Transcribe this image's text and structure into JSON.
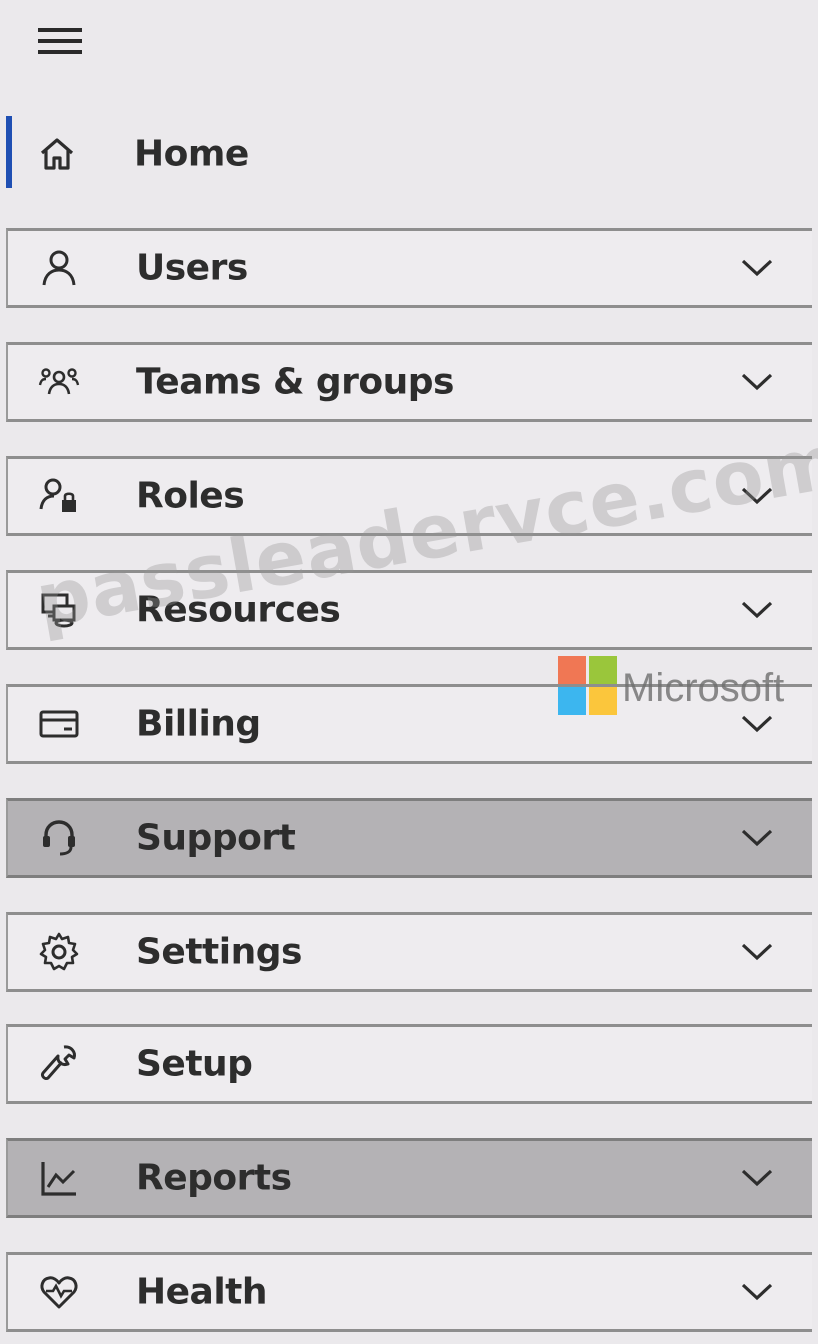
{
  "menu": {
    "toggle_icon": "hamburger-icon",
    "items": [
      {
        "label": "Home",
        "icon": "home-icon",
        "expandable": false,
        "active": true
      },
      {
        "label": "Users",
        "icon": "person-icon",
        "expandable": true
      },
      {
        "label": "Teams & groups",
        "icon": "people-group-icon",
        "expandable": true
      },
      {
        "label": "Roles",
        "icon": "person-lock-icon",
        "expandable": true
      },
      {
        "label": "Resources",
        "icon": "devices-icon",
        "expandable": true
      },
      {
        "label": "Billing",
        "icon": "credit-card-icon",
        "expandable": true
      },
      {
        "label": "Support",
        "icon": "headset-icon",
        "expandable": true,
        "highlighted": true
      },
      {
        "label": "Settings",
        "icon": "gear-icon",
        "expandable": true
      },
      {
        "label": "Setup",
        "icon": "wrench-icon",
        "expandable": false
      },
      {
        "label": "Reports",
        "icon": "line-chart-icon",
        "expandable": true,
        "highlighted": true
      },
      {
        "label": "Health",
        "icon": "heart-pulse-icon",
        "expandable": true
      }
    ]
  },
  "overlay": {
    "watermark_text": "passleadervce.com",
    "logo_text": "Microsoft",
    "logo_colors": [
      "#f25022",
      "#7fba00",
      "#00a4ef",
      "#ffb900"
    ]
  },
  "colors": {
    "active_indicator": "#1f4fb3",
    "highlight_background": "#b4b2b5",
    "background": "#ebe9ec"
  }
}
